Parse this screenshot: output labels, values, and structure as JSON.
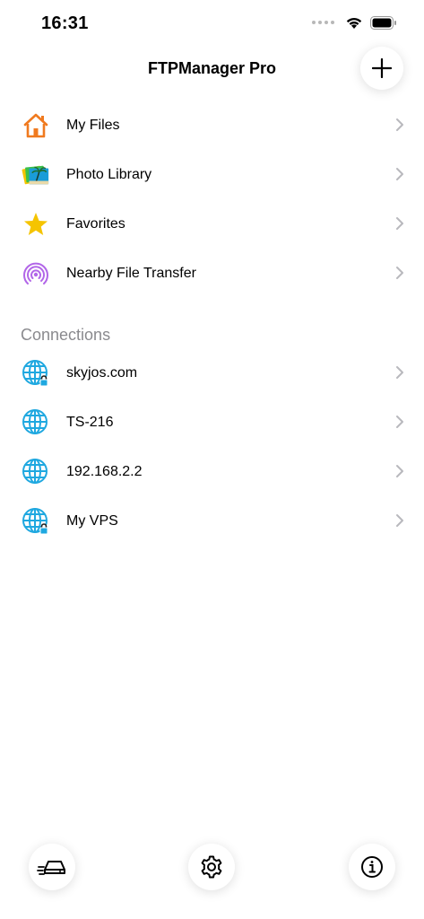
{
  "status_bar": {
    "time": "16:31"
  },
  "header": {
    "title": "FTPManager Pro",
    "add_icon": "plus-icon"
  },
  "places": [
    {
      "label": "My Files",
      "icon": "home-icon"
    },
    {
      "label": "Photo Library",
      "icon": "photos-icon"
    },
    {
      "label": "Favorites",
      "icon": "star-icon"
    },
    {
      "label": "Nearby File Transfer",
      "icon": "airdrop-icon"
    }
  ],
  "connections": {
    "header": "Connections",
    "items": [
      {
        "label": "skyjos.com",
        "icon": "globe-lock-icon"
      },
      {
        "label": "TS-216",
        "icon": "globe-icon"
      },
      {
        "label": "192.168.2.2",
        "icon": "globe-icon"
      },
      {
        "label": "My VPS",
        "icon": "globe-lock-icon"
      }
    ]
  },
  "toolbar": {
    "left_icon": "drive-icon",
    "center_icon": "gear-icon",
    "right_icon": "info-icon"
  },
  "colors": {
    "accent_blue": "#1fa8e0",
    "orange": "#f07a1f",
    "star": "#f5c400",
    "purple": "#b266e8",
    "secondary_text": "#8a8a8e"
  }
}
